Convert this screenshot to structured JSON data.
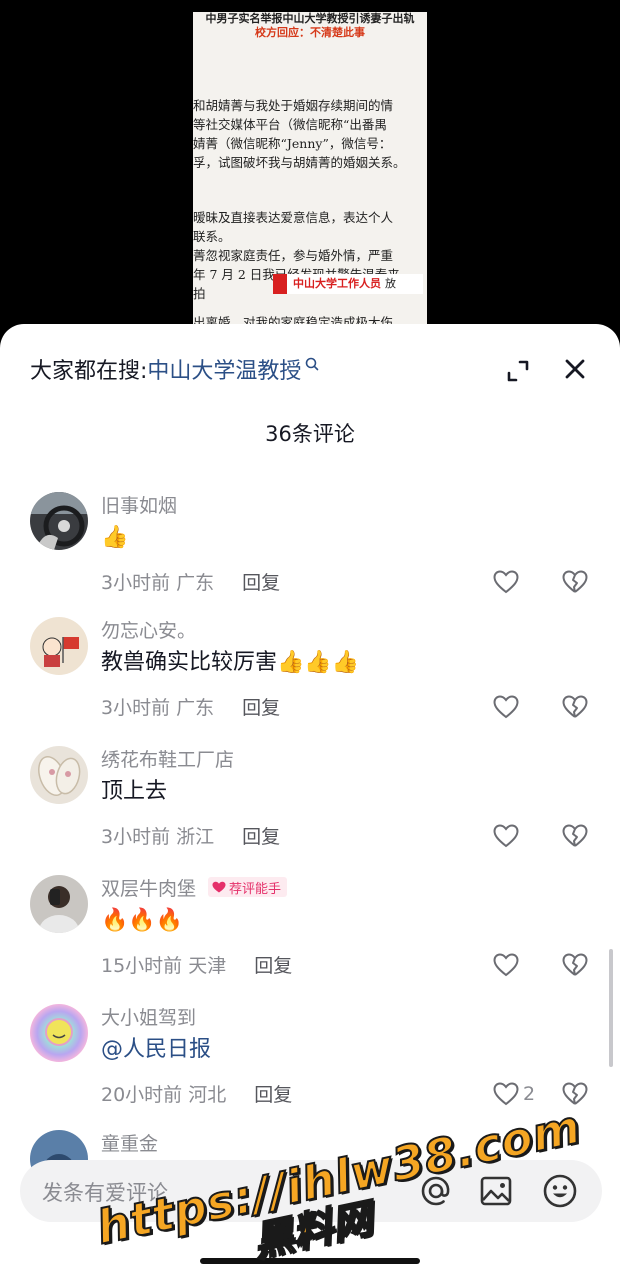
{
  "video": {
    "doc_title_line1": "中男子实名举报中山大学教授引诱妻子出轨",
    "doc_title_line2": "校方回应：不清楚此事",
    "doc_lines": [
      "和胡婧菁与我处于婚姻存续期间的情",
      "等社交媒体平台（微信昵称“出番禺",
      "婧菁（微信昵称“Jenny”，微信号：",
      "孚，试图破坏我与胡婧菁的婚姻关系。",
      "暧昧及直接表达爱意信息，表达个人",
      "联系。",
      "菁忽视家庭责任，参与婚外情，严重",
      "年 7 月 2 日我已经发现并警告温春来",
      "拍",
      "出离婚，对我的家庭稳定造成极大伤"
    ],
    "doc_stamp": "中山大学工作人员",
    "doc_stamp_suffix": "放"
  },
  "header": {
    "search_prefix": "大家都在搜:",
    "search_term": "中山大学温教授",
    "comment_count_title": "36条评论"
  },
  "comments": [
    {
      "username": "旧事如烟",
      "text": "👍",
      "time": "3小时前",
      "location": "广东",
      "reply": "回复",
      "likes": ""
    },
    {
      "username": "勿忘心安。",
      "text": "教兽确实比较厉害👍👍👍",
      "time": "3小时前",
      "location": "广东",
      "reply": "回复",
      "likes": ""
    },
    {
      "username": "绣花布鞋工厂店",
      "text": "顶上去",
      "time": "3小时前",
      "location": "浙江",
      "reply": "回复",
      "likes": ""
    },
    {
      "username": "双层牛肉堡",
      "badge": "荐评能手",
      "text": "🔥🔥🔥",
      "time": "15小时前",
      "location": "天津",
      "reply": "回复",
      "likes": ""
    },
    {
      "username": "大小姐驾到",
      "text": "@人民日报",
      "time": "20小时前",
      "location": "河北",
      "reply": "回复",
      "likes": "2"
    },
    {
      "username": "童重金"
    }
  ],
  "input": {
    "placeholder": "发条有爱评论"
  },
  "watermark": {
    "url": "https://ihlw38.com",
    "name": "黑料网"
  },
  "icons": {
    "search": "search-icon",
    "expand": "expand-icon",
    "close": "close-icon",
    "like": "heart-icon",
    "dislike": "broken-heart-icon",
    "at": "at-icon",
    "image": "image-icon",
    "emoji": "emoji-icon"
  },
  "colors": {
    "link_blue": "#2b4f86",
    "badge_pink": "#e5306a",
    "watermark_orange": "#f5a623",
    "stamp_red": "#d82020"
  }
}
